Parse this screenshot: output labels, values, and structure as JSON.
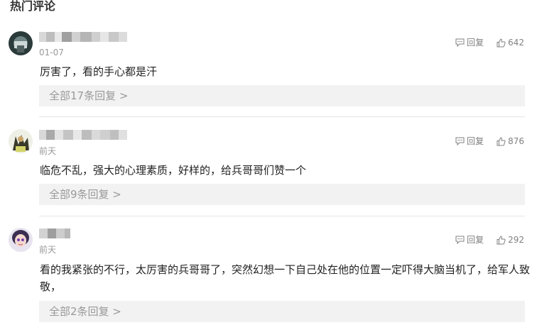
{
  "section_title": "热门评论",
  "actions": {
    "reply_label": "回复"
  },
  "comments": [
    {
      "time": "01-07",
      "text": "厉害了，看的手心都是汗",
      "likes": "642",
      "more_replies": "全部17条回复 >"
    },
    {
      "time": "前天",
      "text": "临危不乱，强大的心理素质，好样的，给兵哥哥们赞一个",
      "likes": "876",
      "more_replies": "全部9条回复 >"
    },
    {
      "time": "前天",
      "text": "看的我紧张的不行，太厉害的兵哥哥了，突然幻想一下自己处在他的位置一定吓得大脑当机了，给军人致敬，",
      "likes": "292",
      "more_replies": "全部2条回复 >"
    }
  ]
}
